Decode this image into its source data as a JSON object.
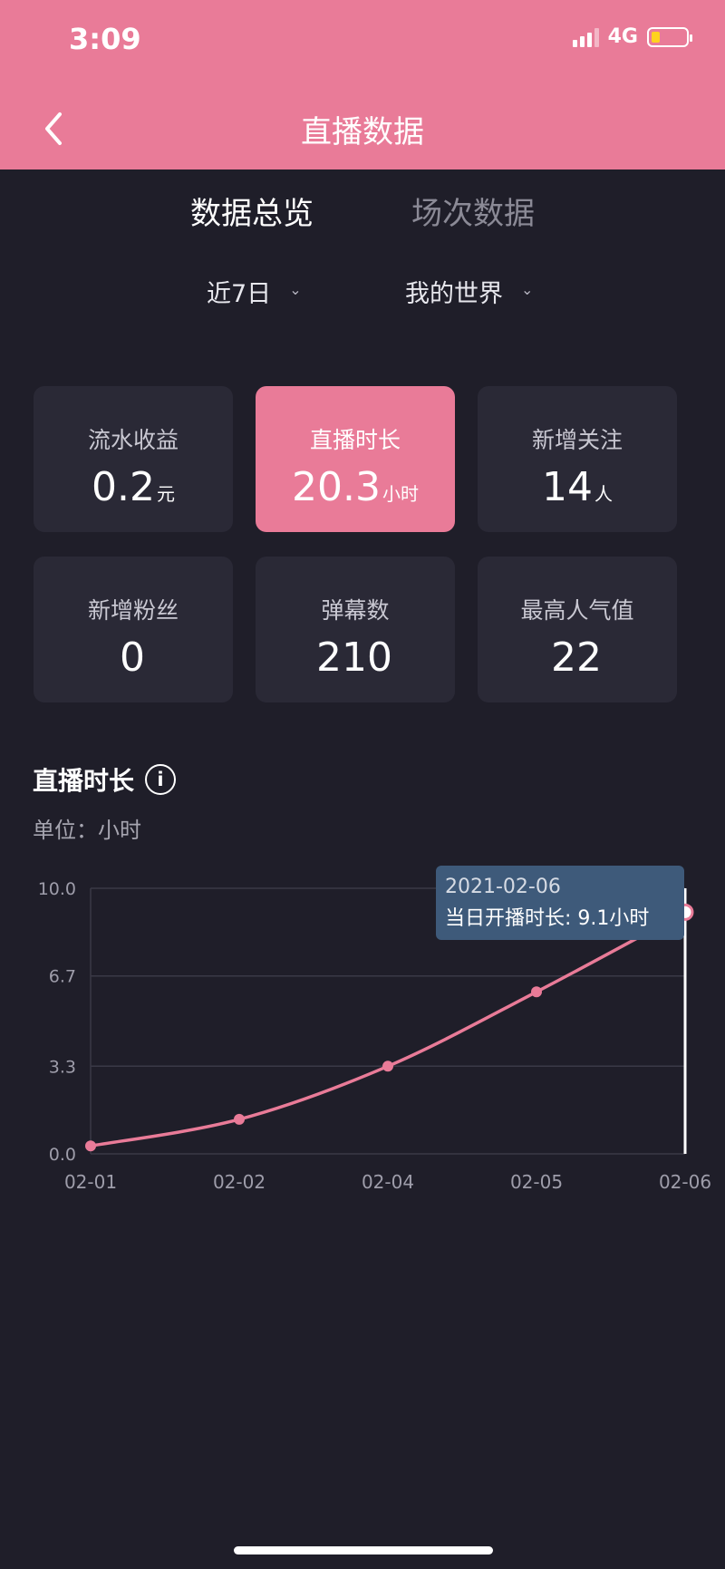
{
  "status": {
    "time": "3:09",
    "network": "4G"
  },
  "header": {
    "title": "直播数据"
  },
  "tabs": [
    {
      "label": "数据总览",
      "active": true
    },
    {
      "label": "场次数据",
      "active": false
    }
  ],
  "filters": {
    "period": "近7日",
    "room": "我的世界"
  },
  "cards": [
    {
      "label": "流水收益",
      "value": "0.2",
      "unit": "元"
    },
    {
      "label": "直播时长",
      "value": "20.3",
      "unit": "小时",
      "active": true
    },
    {
      "label": "新增关注",
      "value": "14",
      "unit": "人"
    },
    {
      "label": "新增粉丝",
      "value": "0",
      "unit": ""
    },
    {
      "label": "弹幕数",
      "value": "210",
      "unit": ""
    },
    {
      "label": "最高人气值",
      "value": "22",
      "unit": ""
    }
  ],
  "section": {
    "title": "直播时长",
    "unit_label": "单位：小时"
  },
  "colors": {
    "accent": "#e97b98",
    "background": "#1f1e29",
    "card": "#2a2936",
    "tooltip": "#3e5a7a"
  },
  "icons": {
    "back": "chevron-left-icon",
    "info": "info-icon"
  },
  "tooltip": {
    "date": "2021-02-06",
    "text": "当日开播时长: 9.1小时"
  },
  "chart_data": {
    "type": "line",
    "x": [
      "02-01",
      "02-02",
      "02-04",
      "02-05",
      "02-06"
    ],
    "values": [
      0.3,
      1.3,
      3.3,
      6.1,
      9.1
    ],
    "ylim": [
      0,
      10
    ],
    "yticks": [
      "0.0",
      "3.3",
      "6.7",
      "10.0"
    ],
    "grid": true,
    "highlight_index": 4
  }
}
